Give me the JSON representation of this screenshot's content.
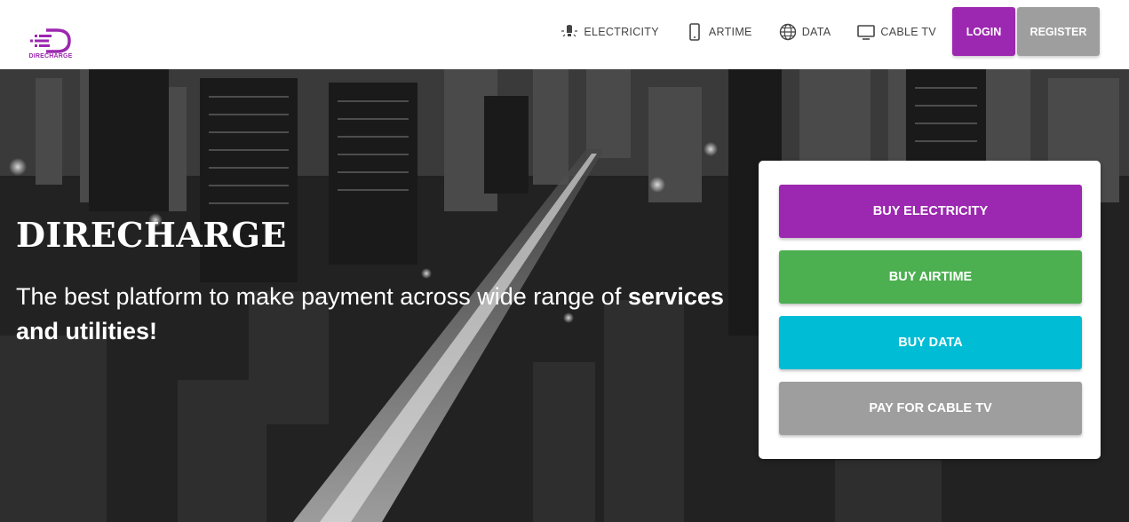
{
  "brand": {
    "logo_text": "DIRECHARGE"
  },
  "nav": {
    "items": [
      {
        "label": "ELECTRICITY",
        "icon": "bulb-icon"
      },
      {
        "label": "ARTIME",
        "icon": "phone-icon"
      },
      {
        "label": "DATA",
        "icon": "globe-icon"
      },
      {
        "label": "CABLE TV",
        "icon": "tv-icon"
      }
    ],
    "login_label": "LOGIN",
    "register_label": "REGISTER"
  },
  "hero": {
    "title": "DIRECHARGE",
    "subtitle_plain": "The best platform to make payment across wide range of ",
    "subtitle_bold_1": "services",
    "subtitle_bold_2": "and utilities!"
  },
  "card": {
    "buttons": [
      {
        "label": "BUY ELECTRICITY",
        "color": "#9c27b0"
      },
      {
        "label": "BUY AIRTIME",
        "color": "#4caf50"
      },
      {
        "label": "BUY DATA",
        "color": "#00bcd4"
      },
      {
        "label": "PAY FOR CABLE TV",
        "color": "#9e9e9e"
      }
    ]
  },
  "colors": {
    "primary": "#9c27b0",
    "success": "#4caf50",
    "info": "#00bcd4",
    "muted": "#9e9e9e"
  }
}
